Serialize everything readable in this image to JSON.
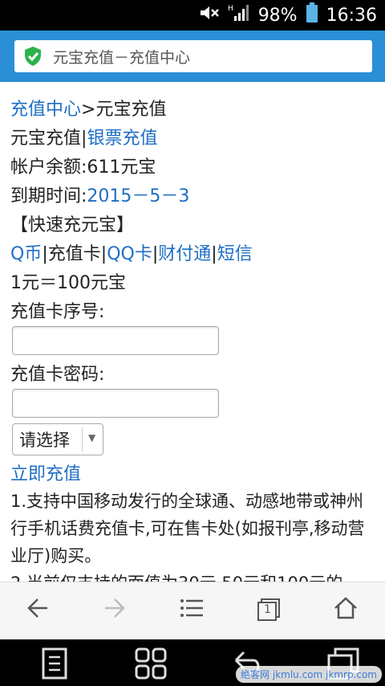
{
  "status_bar": {
    "battery": "98%",
    "time": "16:36",
    "network_icon": "signal-h-icon",
    "sound_icon": "mute-icon"
  },
  "address_bar": {
    "title": "元宝充值－充值中心",
    "security_icon": "shield-check-icon"
  },
  "page": {
    "breadcrumb": {
      "home": "充值中心",
      "sep": ">",
      "current": "元宝充值"
    },
    "recharge_tabs": {
      "yuanbao": "元宝充值",
      "sep": "|",
      "yinpiao": "银票充值"
    },
    "balance": "帐户余额:611元宝",
    "expiry_label": "到期时间:",
    "expiry_value": "2015－5－3",
    "section_title": "【快速充元宝】",
    "methods": {
      "qb": "Q币",
      "card": "充值卡",
      "qqcard": "QQ卡",
      "tenpay": "财付通",
      "sms": "短信",
      "sep": "|"
    },
    "rate": "1元＝100元宝",
    "card_number_label": "充值卡序号:",
    "card_password_label": "充值卡密码:",
    "select_value": "请选择",
    "submit": "立即充值",
    "note1": "1.支持中国移动发行的全球通、动感地带或神州行手机话费充值卡,可在售卡处(如报刊亭,移动营业厅)购买。",
    "note2_partial": "2.当前仅支持的面值为30元,50元和100元的"
  },
  "browser_nav": {
    "back": "back-arrow-icon",
    "forward": "forward-arrow-icon",
    "menu": "menu-icon",
    "tabs": "tabs-icon",
    "tabs_count": "1",
    "home": "home-icon"
  },
  "system_nav": {
    "watermark": "绝客网 jkmlu.com jkmrp.com"
  }
}
